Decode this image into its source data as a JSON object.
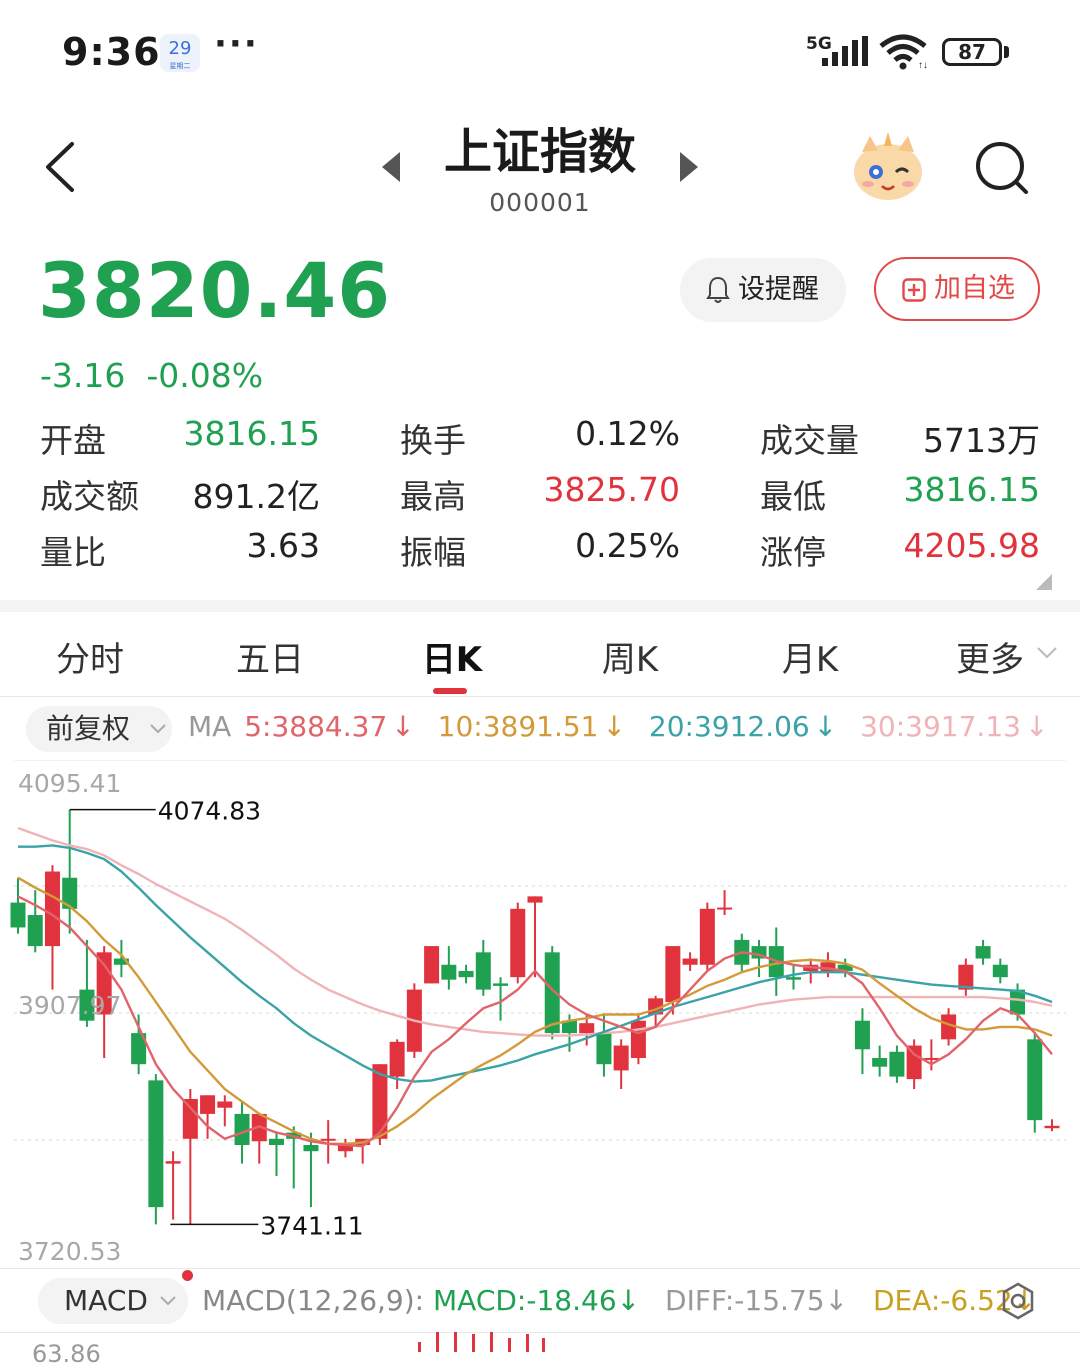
{
  "status_bar": {
    "time": "9:36",
    "calendar_day": "29",
    "calendar_sub": "星期二",
    "network": "5G",
    "battery": "87"
  },
  "header": {
    "title": "上证指数",
    "code": "000001"
  },
  "quote": {
    "price": "3820.46",
    "change": "-3.16",
    "change_pct": "-0.08%",
    "alert_label": "设提醒",
    "watch_label": "加自选"
  },
  "stats": [
    {
      "label": "开盘",
      "value": "3816.15",
      "color": "#20a152"
    },
    {
      "label": "换手",
      "value": "0.12%",
      "color": "#222222"
    },
    {
      "label": "成交量",
      "value": "5713万",
      "color": "#222222"
    },
    {
      "label": "成交额",
      "value": "891.2亿",
      "color": "#222222"
    },
    {
      "label": "最高",
      "value": "3825.70",
      "color": "#e0333e"
    },
    {
      "label": "最低",
      "value": "3816.15",
      "color": "#20a152"
    },
    {
      "label": "量比",
      "value": "3.63",
      "color": "#222222"
    },
    {
      "label": "振幅",
      "value": "0.25%",
      "color": "#222222"
    },
    {
      "label": "涨停",
      "value": "4205.98",
      "color": "#e0333e"
    }
  ],
  "tabs": [
    "分时",
    "五日",
    "日K",
    "周K",
    "月K",
    "更多"
  ],
  "active_tab": "日K",
  "adjust_label": "前复权",
  "ma": {
    "label": "MA",
    "ma5": "5:3884.37",
    "ma10": "10:3891.51",
    "ma20": "20:3912.06",
    "ma30": "30:3917.13",
    "colors": {
      "ma5": "#e0656a",
      "ma10": "#d49a3a",
      "ma20": "#3aa3a8",
      "ma30": "#f0b4b8"
    }
  },
  "chart_data": {
    "type": "candlestick",
    "y_labels": [
      "4095.41",
      "3907.97",
      "3720.53"
    ],
    "ylim": [
      3720.53,
      4095.41
    ],
    "high_annotation": "4074.83",
    "low_annotation": "3741.11",
    "colors": {
      "up": "#e0333e",
      "down": "#20a152"
    },
    "candles": [
      {
        "o": 4000,
        "h": 4020,
        "c": 3980,
        "l": 3975
      },
      {
        "o": 3990,
        "h": 4010,
        "c": 3965,
        "l": 3960
      },
      {
        "o": 3965,
        "h": 4030,
        "c": 4025,
        "l": 3930
      },
      {
        "o": 4020,
        "h": 4074.83,
        "c": 3995,
        "l": 3975
      },
      {
        "o": 3930,
        "h": 3970,
        "c": 3905,
        "l": 3900
      },
      {
        "o": 3910,
        "h": 3965,
        "c": 3960,
        "l": 3875
      },
      {
        "o": 3955,
        "h": 3970,
        "c": 3950,
        "l": 3940
      },
      {
        "o": 3895,
        "h": 3910,
        "c": 3870,
        "l": 3862
      },
      {
        "o": 3857,
        "h": 3862,
        "c": 3755,
        "l": 3741.11
      },
      {
        "o": 3790,
        "h": 3800,
        "c": 3792,
        "l": 3745
      },
      {
        "o": 3810,
        "h": 3850,
        "c": 3842,
        "l": 3741.11
      },
      {
        "o": 3830,
        "h": 3845,
        "c": 3845,
        "l": 3810
      },
      {
        "o": 3835,
        "h": 3845,
        "c": 3840,
        "l": 3820
      },
      {
        "o": 3830,
        "h": 3840,
        "c": 3805,
        "l": 3790
      },
      {
        "o": 3808,
        "h": 3830,
        "c": 3830,
        "l": 3790
      },
      {
        "o": 3810,
        "h": 3815,
        "c": 3805,
        "l": 3780
      },
      {
        "o": 3815,
        "h": 3820,
        "c": 3810,
        "l": 3770
      },
      {
        "o": 3805,
        "h": 3815,
        "c": 3800,
        "l": 3755
      },
      {
        "o": 3810,
        "h": 3825,
        "c": 3810,
        "l": 3790
      },
      {
        "o": 3800,
        "h": 3810,
        "c": 3805,
        "l": 3795
      },
      {
        "o": 3805,
        "h": 3810,
        "c": 3810,
        "l": 3790
      },
      {
        "o": 3810,
        "h": 3870,
        "c": 3870,
        "l": 3805
      },
      {
        "o": 3860,
        "h": 3890,
        "c": 3888,
        "l": 3850
      },
      {
        "o": 3880,
        "h": 3935,
        "c": 3930,
        "l": 3875
      },
      {
        "o": 3935,
        "h": 3965,
        "c": 3965,
        "l": 3935
      },
      {
        "o": 3950,
        "h": 3965,
        "c": 3938,
        "l": 3930
      },
      {
        "o": 3945,
        "h": 3950,
        "c": 3940,
        "l": 3935
      },
      {
        "o": 3960,
        "h": 3970,
        "c": 3930,
        "l": 3925
      },
      {
        "o": 3935,
        "h": 3940,
        "c": 3933,
        "l": 3905
      },
      {
        "o": 3940,
        "h": 4000,
        "c": 3995,
        "l": 3935
      },
      {
        "o": 4000,
        "h": 4005,
        "c": 4005,
        "l": 3940
      },
      {
        "o": 3960,
        "h": 3965,
        "c": 3895,
        "l": 3890
      },
      {
        "o": 3905,
        "h": 3910,
        "c": 3895,
        "l": 3880
      },
      {
        "o": 3895,
        "h": 3910,
        "c": 3903,
        "l": 3885
      },
      {
        "o": 3895,
        "h": 3910,
        "c": 3870,
        "l": 3860
      },
      {
        "o": 3865,
        "h": 3890,
        "c": 3885,
        "l": 3850
      },
      {
        "o": 3875,
        "h": 3910,
        "c": 3905,
        "l": 3870
      },
      {
        "o": 3910,
        "h": 3925,
        "c": 3923,
        "l": 3900
      },
      {
        "o": 3920,
        "h": 3965,
        "c": 3965,
        "l": 3910
      },
      {
        "o": 3950,
        "h": 3960,
        "c": 3955,
        "l": 3945
      },
      {
        "o": 3950,
        "h": 4000,
        "c": 3995,
        "l": 3945
      },
      {
        "o": 3995,
        "h": 4010,
        "c": 3996,
        "l": 3990
      },
      {
        "o": 3970,
        "h": 3975,
        "c": 3950,
        "l": 3945
      },
      {
        "o": 3965,
        "h": 3970,
        "c": 3955,
        "l": 3940
      },
      {
        "o": 3965,
        "h": 3980,
        "c": 3940,
        "l": 3925
      },
      {
        "o": 3940,
        "h": 3950,
        "c": 3938,
        "l": 3930
      },
      {
        "o": 3945,
        "h": 3955,
        "c": 3950,
        "l": 3935
      },
      {
        "o": 3945,
        "h": 3960,
        "c": 3952,
        "l": 3940
      },
      {
        "o": 3950,
        "h": 3955,
        "c": 3945,
        "l": 3940
      },
      {
        "o": 3905,
        "h": 3915,
        "c": 3882,
        "l": 3862
      },
      {
        "o": 3875,
        "h": 3885,
        "c": 3868,
        "l": 3860
      },
      {
        "o": 3880,
        "h": 3885,
        "c": 3860,
        "l": 3855
      },
      {
        "o": 3858,
        "h": 3890,
        "c": 3885,
        "l": 3850
      },
      {
        "o": 3875,
        "h": 3890,
        "c": 3875,
        "l": 3865
      },
      {
        "o": 3890,
        "h": 3915,
        "c": 3910,
        "l": 3885
      },
      {
        "o": 3930,
        "h": 3955,
        "c": 3950,
        "l": 3925
      },
      {
        "o": 3965,
        "h": 3970,
        "c": 3955,
        "l": 3950
      },
      {
        "o": 3950,
        "h": 3955,
        "c": 3940,
        "l": 3935
      },
      {
        "o": 3930,
        "h": 3935,
        "c": 3910,
        "l": 3905
      },
      {
        "o": 3890,
        "h": 3895,
        "c": 3825,
        "l": 3815
      },
      {
        "o": 3818.5,
        "h": 3825.7,
        "c": 3820.46,
        "l": 3816.15
      }
    ],
    "ma_lines": {
      "ma5": [
        4005,
        3998,
        3990,
        3980,
        3965,
        3950,
        3930,
        3900,
        3870,
        3850,
        3835,
        3820,
        3810,
        3815,
        3820,
        3815,
        3812,
        3808,
        3806,
        3805,
        3804,
        3815,
        3835,
        3860,
        3880,
        3890,
        3903,
        3915,
        3920,
        3930,
        3945,
        3930,
        3918,
        3910,
        3905,
        3900,
        3895,
        3900,
        3915,
        3930,
        3945,
        3955,
        3960,
        3958,
        3953,
        3950,
        3948,
        3947,
        3945,
        3935,
        3915,
        3893,
        3878,
        3870,
        3878,
        3890,
        3905,
        3915,
        3910,
        3895,
        3878
      ],
      "ma10": [
        4020,
        4012,
        4005,
        3997,
        3985,
        3970,
        3958,
        3940,
        3920,
        3900,
        3880,
        3865,
        3850,
        3840,
        3830,
        3823,
        3816,
        3810,
        3806,
        3806,
        3807,
        3812,
        3820,
        3830,
        3842,
        3852,
        3862,
        3870,
        3877,
        3886,
        3896,
        3902,
        3905,
        3907,
        3910,
        3910,
        3910,
        3914,
        3920,
        3926,
        3933,
        3938,
        3944,
        3948,
        3951,
        3953,
        3954,
        3953,
        3951,
        3946,
        3935,
        3925,
        3915,
        3907,
        3902,
        3898,
        3898,
        3900,
        3900,
        3898,
        3893
      ],
      "ma20": [
        4045,
        4045,
        4046,
        4044,
        4040,
        4035,
        4025,
        4012,
        3998,
        3985,
        3972,
        3960,
        3948,
        3936,
        3925,
        3915,
        3903,
        3893,
        3885,
        3877,
        3869,
        3862,
        3858,
        3856,
        3857,
        3860,
        3863,
        3866,
        3869,
        3873,
        3878,
        3882,
        3886,
        3891,
        3896,
        3901,
        3906,
        3911,
        3916,
        3920,
        3924,
        3928,
        3932,
        3936,
        3939,
        3942,
        3944,
        3944,
        3944,
        3942,
        3940,
        3938,
        3936,
        3934,
        3933,
        3932,
        3931,
        3930,
        3929,
        3925,
        3920
      ],
      "ma30": [
        4060,
        4055,
        4050,
        4046,
        4043,
        4038,
        4030,
        4023,
        4015,
        4008,
        4001,
        3994,
        3987,
        3978,
        3968,
        3958,
        3947,
        3938,
        3930,
        3924,
        3918,
        3913,
        3909,
        3905,
        3902,
        3900,
        3898,
        3896,
        3895,
        3894,
        3893,
        3893,
        3893,
        3894,
        3895,
        3896,
        3898,
        3900,
        3903,
        3906,
        3909,
        3912,
        3915,
        3918,
        3920,
        3922,
        3923,
        3924,
        3924,
        3924,
        3924,
        3924,
        3924,
        3924,
        3924,
        3924,
        3924,
        3923,
        3922,
        3920,
        3917
      ]
    }
  },
  "macd": {
    "button_label": "MACD",
    "params": "MACD(12,26,9):",
    "macd": "MACD:-18.46",
    "diff": "DIFF:-15.75",
    "dea": "DEA:-6.52",
    "partial_axis": "63.86"
  }
}
